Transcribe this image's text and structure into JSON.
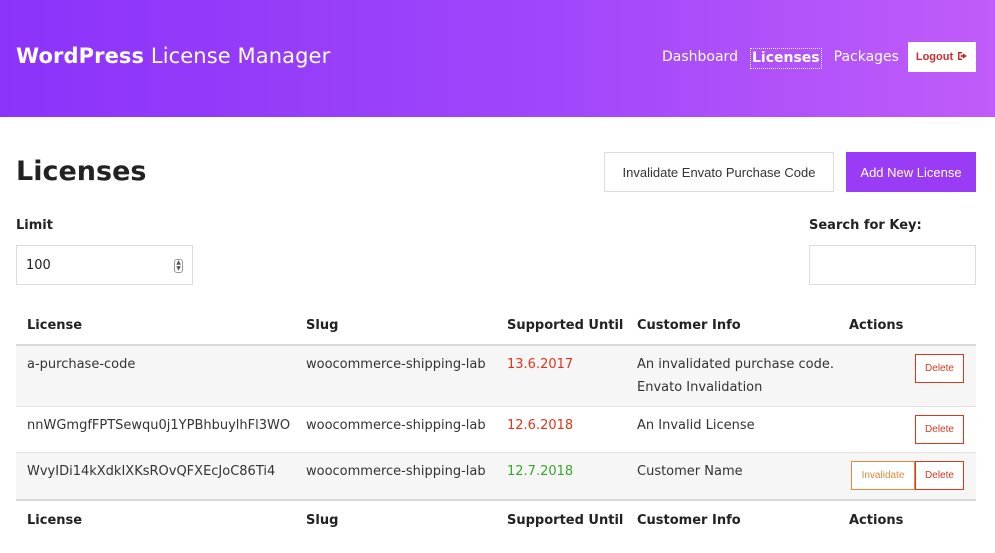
{
  "header": {
    "brand_bold": "WordPress",
    "brand_light": "License Manager",
    "nav": [
      {
        "label": "Dashboard"
      },
      {
        "label": "Licenses",
        "active": true
      },
      {
        "label": "Packages"
      }
    ],
    "logout_label": "Logout",
    "logout_icon": "sign-out-icon"
  },
  "page": {
    "title": "Licenses",
    "invalidate_button": "Invalidate Envato Purchase Code",
    "add_button": "Add New License"
  },
  "filters": {
    "limit_label": "Limit",
    "limit_value": "100",
    "search_label": "Search for Key:",
    "search_value": ""
  },
  "table": {
    "columns": [
      "License",
      "Slug",
      "Supported Until",
      "Customer Info",
      "Actions"
    ],
    "rows": [
      {
        "license": "a-purchase-code",
        "slug": "woocommerce-shipping-lab",
        "supported_until": "13.6.2017",
        "info_line1": "An invalidated purchase code.",
        "info_line2": "Envato Invalidation",
        "actions": [
          "Delete"
        ]
      },
      {
        "license": "nnWGmgfFPTSewqu0j1YPBhbuylhFl3WO",
        "slug": "woocommerce-shipping-lab",
        "supported_until": "12.6.2018",
        "info_line1": "An Invalid License",
        "actions": [
          "Delete"
        ]
      },
      {
        "license": "WvyIDi14kXdkIXKsROvQFXEcJoC86Ti4",
        "slug": "woocommerce-shipping-lab",
        "supported_until": "12.7.2018",
        "info_line1": "Customer Name",
        "actions": [
          "Invalidate",
          "Delete"
        ]
      }
    ]
  },
  "colors": {
    "header_start": "#8b33fa",
    "header_end": "#c05cf9",
    "primary": "#9a3cf5",
    "expired": "#e0341b",
    "valid": "#36a82a",
    "danger": "#d9381e",
    "warning": "#e08a3e"
  }
}
